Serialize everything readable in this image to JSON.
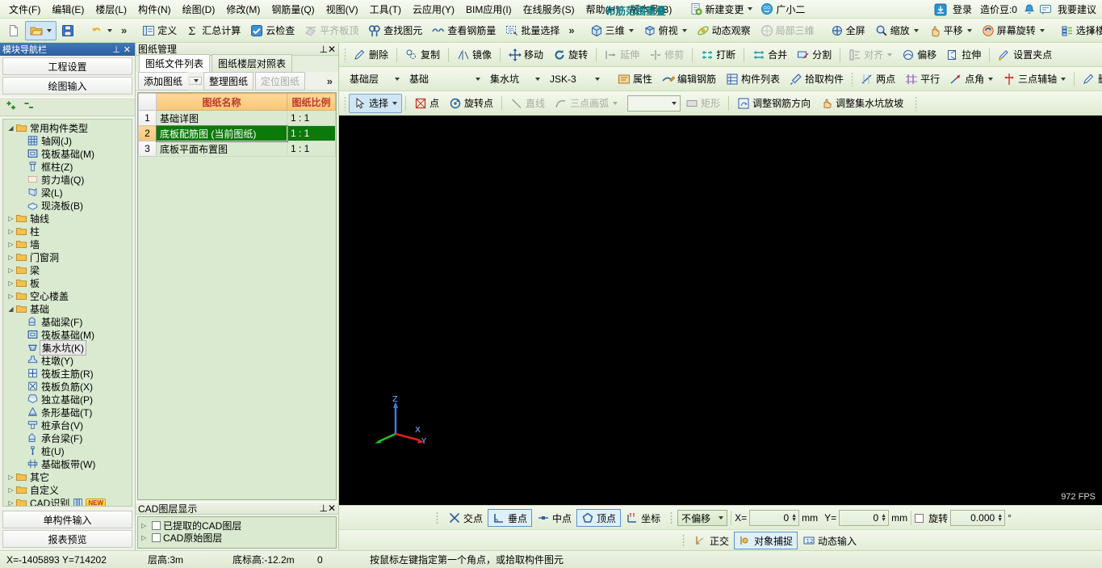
{
  "menubar": {
    "items": [
      {
        "label": "文件(F)"
      },
      {
        "label": "编辑(E)"
      },
      {
        "label": "楼层(L)"
      },
      {
        "label": "构件(N)"
      },
      {
        "label": "绘图(D)"
      },
      {
        "label": "修改(M)"
      },
      {
        "label": "钢筋量(Q)"
      },
      {
        "label": "视图(V)"
      },
      {
        "label": "工具(T)"
      },
      {
        "label": "云应用(Y)"
      },
      {
        "label": "BIM应用(I)"
      },
      {
        "label": "在线服务(S)"
      },
      {
        "label": "帮助(H)"
      },
      {
        "label": "版本号(B)"
      }
    ],
    "new_change": "新建变更",
    "user_name": "广小二",
    "banner_note": "布筋范围重叠",
    "login": "登录",
    "coin_label": "造价豆:0",
    "suggest": "我要建议"
  },
  "toolbar1": {
    "items": [
      {
        "name": "new",
        "icon": "new-file-icon",
        "label": "",
        "disabled": false
      },
      {
        "name": "open",
        "icon": "open-folder-icon",
        "label": "",
        "disabled": false
      },
      {
        "name": "save",
        "icon": "save-icon",
        "label": "",
        "disabled": false
      },
      {
        "name": "undo",
        "icon": "undo-icon",
        "label": "",
        "disabled": false
      }
    ],
    "group2": [
      {
        "label": "定义",
        "icon": "define-icon",
        "disabled": false
      },
      {
        "label": "汇总计算",
        "icon": "sigma-icon",
        "disabled": false
      },
      {
        "label": "云检查",
        "icon": "cloud-check-icon",
        "disabled": false
      },
      {
        "label": "平齐板顶",
        "icon": "align-slab-icon",
        "disabled": true
      },
      {
        "label": "查找图元",
        "icon": "find-element-icon",
        "disabled": false
      },
      {
        "label": "查看钢筋量",
        "icon": "view-rebar-icon",
        "disabled": false
      },
      {
        "label": "批量选择",
        "icon": "batch-select-icon",
        "disabled": false
      }
    ],
    "group3": [
      {
        "label": "三维",
        "icon": "cube-3d-icon",
        "disabled": false,
        "dropdown": true
      },
      {
        "label": "俯视",
        "icon": "topview-icon",
        "disabled": false,
        "dropdown": true
      },
      {
        "label": "动态观察",
        "icon": "orbit-icon",
        "disabled": false,
        "dropdown": false
      },
      {
        "label": "局部三维",
        "icon": "local-3d-icon",
        "disabled": true,
        "dropdown": false
      },
      {
        "label": "全屏",
        "icon": "fullscreen-icon",
        "disabled": false,
        "dropdown": false
      },
      {
        "label": "缩放",
        "icon": "zoom-icon",
        "disabled": false,
        "dropdown": true
      },
      {
        "label": "平移",
        "icon": "pan-icon",
        "disabled": false,
        "dropdown": true
      },
      {
        "label": "屏幕旋转",
        "icon": "screen-rotate-icon",
        "disabled": false,
        "dropdown": true
      },
      {
        "label": "选择楼层",
        "icon": "select-floor-icon",
        "disabled": false,
        "dropdown": false
      }
    ]
  },
  "toolbar2": {
    "items": [
      {
        "label": "删除",
        "icon": "delete-icon",
        "disabled": false
      },
      {
        "label": "复制",
        "icon": "copy-icon",
        "disabled": false
      },
      {
        "label": "镜像",
        "icon": "mirror-icon",
        "disabled": false
      },
      {
        "label": "移动",
        "icon": "move-icon",
        "disabled": false
      },
      {
        "label": "旋转",
        "icon": "rotate-icon",
        "disabled": false
      },
      {
        "label": "延伸",
        "icon": "extend-icon",
        "disabled": true
      },
      {
        "label": "修剪",
        "icon": "trim-icon",
        "disabled": true
      },
      {
        "label": "打断",
        "icon": "break-icon",
        "disabled": false
      },
      {
        "label": "合并",
        "icon": "merge-icon",
        "disabled": false
      },
      {
        "label": "分割",
        "icon": "split-icon",
        "disabled": false
      },
      {
        "label": "对齐",
        "icon": "align-icon",
        "disabled": true,
        "dropdown": true
      },
      {
        "label": "偏移",
        "icon": "offset-icon",
        "disabled": false
      },
      {
        "label": "拉伸",
        "icon": "stretch-icon",
        "disabled": false
      },
      {
        "label": "设置夹点",
        "icon": "set-grip-icon",
        "disabled": false
      }
    ]
  },
  "toolbar3": {
    "selectors": [
      {
        "name": "floor-select",
        "value": "基础层"
      },
      {
        "name": "category-select",
        "value": "基础"
      },
      {
        "name": "component-type-select",
        "value": "集水坑"
      },
      {
        "name": "component-select",
        "value": "JSK-3"
      }
    ],
    "items": [
      {
        "label": "属性",
        "icon": "properties-icon",
        "disabled": false
      },
      {
        "label": "编辑钢筋",
        "icon": "edit-rebar-icon",
        "disabled": false
      },
      {
        "label": "构件列表",
        "icon": "component-list-icon",
        "disabled": false
      },
      {
        "label": "拾取构件",
        "icon": "pick-component-icon",
        "disabled": false
      },
      {
        "label": "两点",
        "icon": "two-point-icon",
        "disabled": false
      },
      {
        "label": "平行",
        "icon": "parallel-icon",
        "disabled": false
      },
      {
        "label": "点角",
        "icon": "point-angle-icon",
        "disabled": false,
        "dropdown": true
      },
      {
        "label": "三点辅轴",
        "icon": "three-point-axis-icon",
        "disabled": false,
        "dropdown": true
      },
      {
        "label": "删除辅轴",
        "icon": "delete-axis-icon",
        "disabled": false
      }
    ]
  },
  "toolbar4": {
    "items": [
      {
        "label": "选择",
        "icon": "cursor-select-icon",
        "disabled": false,
        "active": true,
        "dropdown": true
      },
      {
        "label": "点",
        "icon": "point-icon",
        "disabled": false,
        "active": false
      },
      {
        "label": "旋转点",
        "icon": "rotate-point-icon",
        "disabled": false,
        "active": false
      },
      {
        "label": "直线",
        "icon": "line-icon",
        "disabled": true,
        "active": false
      },
      {
        "label": "三点画弧",
        "icon": "three-point-arc-icon",
        "disabled": true,
        "active": false,
        "dropdown": true
      },
      {
        "label": "矩形",
        "icon": "rectangle-icon",
        "disabled": true,
        "active": false
      },
      {
        "label": "调整钢筋方向",
        "icon": "adjust-rebar-dir-icon",
        "disabled": false,
        "active": false
      },
      {
        "label": "调整集水坑放坡",
        "icon": "adjust-sump-slope-icon",
        "disabled": false,
        "active": false
      }
    ],
    "empty_combo": ""
  },
  "leftnav": {
    "title": "模块导航栏",
    "buttons_top": [
      {
        "label": "工程设置"
      },
      {
        "label": "绘图输入"
      }
    ],
    "buttons_bottom": [
      {
        "label": "单构件输入"
      },
      {
        "label": "报表预览"
      }
    ],
    "tree": [
      {
        "label": "常用构件类型",
        "type": "folder",
        "level": 0,
        "expanded": true
      },
      {
        "label": "轴网(J)",
        "type": "leaf",
        "level": 1,
        "icon": "grid-icon"
      },
      {
        "label": "筏板基础(M)",
        "type": "leaf",
        "level": 1,
        "icon": "raft-foundation-icon"
      },
      {
        "label": "框柱(Z)",
        "type": "leaf",
        "level": 1,
        "icon": "frame-column-icon"
      },
      {
        "label": "剪力墙(Q)",
        "type": "leaf",
        "level": 1,
        "icon": "shear-wall-icon"
      },
      {
        "label": "梁(L)",
        "type": "leaf",
        "level": 1,
        "icon": "beam-icon"
      },
      {
        "label": "现浇板(B)",
        "type": "leaf",
        "level": 1,
        "icon": "slab-icon"
      },
      {
        "label": "轴线",
        "type": "folder",
        "level": 0,
        "expanded": false
      },
      {
        "label": "柱",
        "type": "folder",
        "level": 0,
        "expanded": false
      },
      {
        "label": "墙",
        "type": "folder",
        "level": 0,
        "expanded": false
      },
      {
        "label": "门窗洞",
        "type": "folder",
        "level": 0,
        "expanded": false
      },
      {
        "label": "梁",
        "type": "folder",
        "level": 0,
        "expanded": false
      },
      {
        "label": "板",
        "type": "folder",
        "level": 0,
        "expanded": false
      },
      {
        "label": "空心楼盖",
        "type": "folder",
        "level": 0,
        "expanded": false
      },
      {
        "label": "基础",
        "type": "folder",
        "level": 0,
        "expanded": true
      },
      {
        "label": "基础梁(F)",
        "type": "leaf",
        "level": 1,
        "icon": "foundation-beam-icon"
      },
      {
        "label": "筏板基础(M)",
        "type": "leaf",
        "level": 1,
        "icon": "raft-foundation-icon"
      },
      {
        "label": "集水坑(K)",
        "type": "leaf",
        "level": 1,
        "icon": "sump-pit-icon",
        "selected": true
      },
      {
        "label": "柱墩(Y)",
        "type": "leaf",
        "level": 1,
        "icon": "column-pier-icon"
      },
      {
        "label": "筏板主筋(R)",
        "type": "leaf",
        "level": 1,
        "icon": "raft-main-rebar-icon"
      },
      {
        "label": "筏板负筋(X)",
        "type": "leaf",
        "level": 1,
        "icon": "raft-neg-rebar-icon"
      },
      {
        "label": "独立基础(P)",
        "type": "leaf",
        "level": 1,
        "icon": "isolated-foundation-icon"
      },
      {
        "label": "条形基础(T)",
        "type": "leaf",
        "level": 1,
        "icon": "strip-foundation-icon"
      },
      {
        "label": "桩承台(V)",
        "type": "leaf",
        "level": 1,
        "icon": "pile-cap-icon"
      },
      {
        "label": "承台梁(F)",
        "type": "leaf",
        "level": 1,
        "icon": "cap-beam-icon"
      },
      {
        "label": "桩(U)",
        "type": "leaf",
        "level": 1,
        "icon": "pile-icon"
      },
      {
        "label": "基础板带(W)",
        "type": "leaf",
        "level": 1,
        "icon": "foundation-band-icon"
      },
      {
        "label": "其它",
        "type": "folder",
        "level": 0,
        "expanded": false
      },
      {
        "label": "自定义",
        "type": "folder",
        "level": 0,
        "expanded": false
      },
      {
        "label": "CAD识别",
        "type": "folder",
        "level": 0,
        "expanded": false,
        "badge": "NEW"
      }
    ]
  },
  "drawing_manager": {
    "title": "图纸管理",
    "tabs": [
      {
        "label": "图纸文件列表",
        "active": true
      },
      {
        "label": "图纸楼层对照表",
        "active": false
      }
    ],
    "tools": [
      {
        "label": "添加图纸",
        "disabled": false,
        "dropdown": true
      },
      {
        "label": "整理图纸",
        "disabled": false,
        "dropdown": false
      },
      {
        "label": "定位图纸",
        "disabled": true,
        "dropdown": false
      }
    ],
    "columns": [
      "",
      "图纸名称",
      "图纸比例"
    ],
    "rows": [
      {
        "idx": "1",
        "name": "基础详图",
        "scale": "1 : 1",
        "selected": false
      },
      {
        "idx": "2",
        "name": "底板配筋图 (当前图纸)",
        "scale": "1 : 1",
        "selected": true
      },
      {
        "idx": "3",
        "name": "底板平面布置图",
        "scale": "1 : 1",
        "selected": false
      }
    ]
  },
  "cad_layer": {
    "title": "CAD图层显示",
    "items": [
      {
        "label": "已提取的CAD图层",
        "checked": false
      },
      {
        "label": "CAD原始图层",
        "checked": false
      }
    ]
  },
  "snapbar": {
    "items": [
      {
        "label": "交点",
        "icon": "intersection-snap-icon",
        "on": false
      },
      {
        "label": "垂点",
        "icon": "perpendicular-snap-icon",
        "on": true
      },
      {
        "label": "中点",
        "icon": "midpoint-snap-icon",
        "on": false
      },
      {
        "label": "顶点",
        "icon": "vertex-snap-icon",
        "on": true
      },
      {
        "label": "坐标",
        "icon": "coordinate-snap-icon",
        "on": false
      }
    ],
    "offset_mode": "不偏移",
    "x_label": "X=",
    "x_value": "0",
    "x_unit": "mm",
    "y_label": "Y=",
    "y_value": "0",
    "y_unit": "mm",
    "rotate_label": "旋转",
    "rotate_value": "0.000",
    "rotate_unit": "°"
  },
  "modebar": {
    "items": [
      {
        "label": "正交",
        "icon": "ortho-icon",
        "on": false
      },
      {
        "label": "对象捕捉",
        "icon": "object-snap-icon",
        "on": true
      },
      {
        "label": "动态输入",
        "icon": "dynamic-input-icon",
        "on": false
      }
    ]
  },
  "statusbar": {
    "coords": "X=-1405893  Y=714202",
    "floor_height": "层高:3m",
    "base_elevation": "底标高:-12.2m",
    "value": "0",
    "hint": "按鼠标左键指定第一个角点，或拾取构件图元"
  },
  "canvas": {
    "fps": "972 FPS",
    "axis_x": "X",
    "axis_y": "Y",
    "axis_z": "Z"
  },
  "colors": {
    "accent_blue": "#2c5e9e",
    "selection_green": "#0b7a0b",
    "header_orange": "#f8c675",
    "header_text_red": "#c0392b",
    "banner_teal": "#0b7d86",
    "canvas_black": "#000000",
    "panel_green": "#d9ead0"
  }
}
